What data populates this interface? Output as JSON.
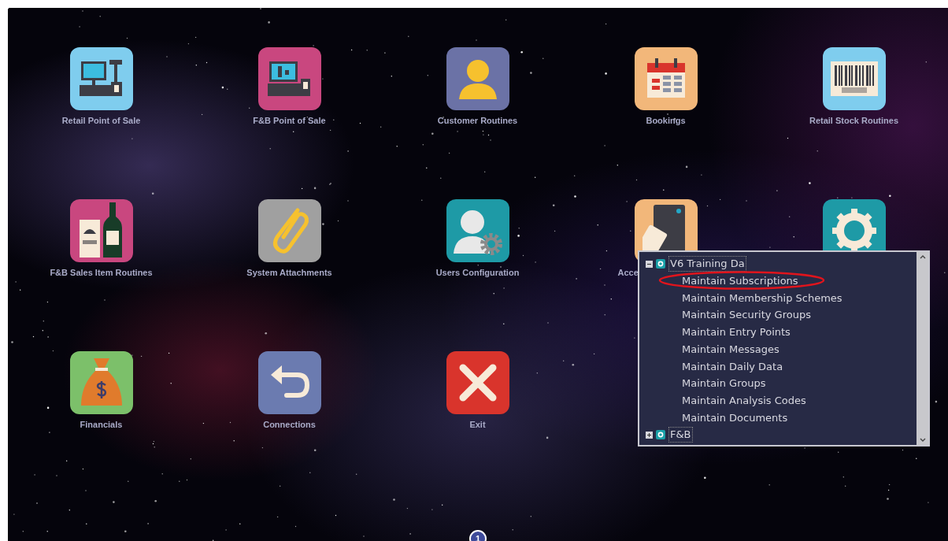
{
  "tiles": [
    {
      "label": "Retail Point of Sale",
      "kind": "retail-pos",
      "color": "#7fcdee"
    },
    {
      "label": "F&B Point of Sale",
      "kind": "fb-pos",
      "color": "#c9477f"
    },
    {
      "label": "Customer Routines",
      "kind": "customer",
      "color": "#6b72a6"
    },
    {
      "label": "Bookings",
      "kind": "calendar",
      "color": "#f2b77a"
    },
    {
      "label": "Retail Stock Routines",
      "kind": "barcode",
      "color": "#7fcdee"
    },
    {
      "label": "F&B Sales Item Routines",
      "kind": "menu",
      "color": "#c9477f"
    },
    {
      "label": "System Attachments",
      "kind": "paperclip",
      "color": "#a0a0a0"
    },
    {
      "label": "Users Configuration",
      "kind": "user-gear",
      "color": "#1e9aa6"
    },
    {
      "label": "Acce",
      "kind": "card",
      "color": "#f2b77a"
    },
    {
      "kind": "gear",
      "color": "#1e9aa6"
    },
    {
      "label": "Financials",
      "kind": "money",
      "color": "#7cc06a"
    },
    {
      "label": "Connections",
      "kind": "back",
      "color": "#6b7bb0"
    },
    {
      "label": "Exit",
      "kind": "exit",
      "color": "#d9342c"
    }
  ],
  "tree": [
    {
      "label": "V6 Training Da",
      "expanded": true,
      "children": [
        {
          "label": "Maintain Subscriptions"
        },
        {
          "label": "Maintain Membership Schemes"
        },
        {
          "label": "Maintain Security Groups"
        },
        {
          "label": "Maintain Entry Points"
        },
        {
          "label": "Maintain Messages"
        },
        {
          "label": "Maintain Daily Data"
        },
        {
          "label": "Maintain Groups"
        },
        {
          "label": "Maintain Analysis Codes"
        },
        {
          "label": "Maintain Documents"
        }
      ]
    },
    {
      "label": "F&B",
      "expanded": false
    }
  ],
  "page_badge": "1"
}
